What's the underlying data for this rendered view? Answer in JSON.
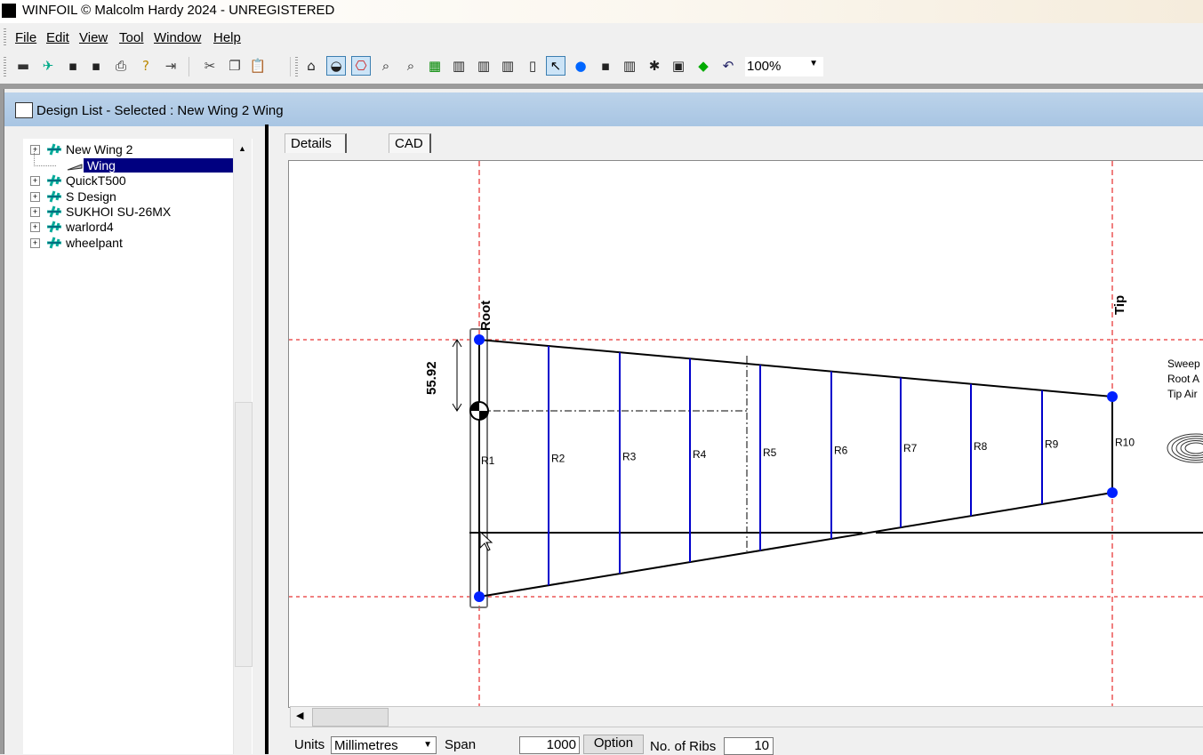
{
  "window": {
    "title": "WINFOIL © Malcolm Hardy 2024 - UNREGISTERED"
  },
  "menu": [
    "File",
    "Edit",
    "View",
    "Tool",
    "Window",
    "Help"
  ],
  "toolbar": {
    "icons": [
      "new-wing-icon",
      "new-design-icon",
      "save-icon",
      "save-as-icon",
      "print-icon",
      "help-icon",
      "exit-icon",
      "cut-icon",
      "copy-icon",
      "paste-icon",
      "plan-view-icon",
      "airfoil-view-icon",
      "outline-view-icon",
      "zoom-in-icon",
      "zoom-out-icon",
      "table-icon",
      "rib-chart-icon",
      "spar-chart-icon",
      "template-chart-icon",
      "panel-icon",
      "select-pointer-icon",
      "add-point-icon",
      "save-icon",
      "delete-icon",
      "tools-icon",
      "properties-icon",
      "color-icon",
      "undo-icon"
    ],
    "zoom": "100%"
  },
  "child": {
    "title": "Design List - Selected : New Wing 2 Wing"
  },
  "tree": [
    {
      "label": "New Wing 2",
      "expand": "+"
    },
    {
      "label": "Wing",
      "child": true,
      "selected": true
    },
    {
      "label": "QuickT500",
      "expand": "+"
    },
    {
      "label": "S Design",
      "expand": "+"
    },
    {
      "label": "SUKHOI SU-26MX",
      "expand": "+"
    },
    {
      "label": "warlord4",
      "expand": "+"
    },
    {
      "label": "wheelpant",
      "expand": "+"
    }
  ],
  "tabs": {
    "details": "Details",
    "cad": "CAD"
  },
  "drawing": {
    "root_label": "Root",
    "tip_label": "Tip",
    "dimension": "55.92",
    "ribs": [
      "R1",
      "R2",
      "R3",
      "R4",
      "R5",
      "R6",
      "R7",
      "R8",
      "R9",
      "R10"
    ],
    "info_lines": [
      "Sweep",
      "Root A",
      "Tip Air"
    ],
    "colors": {
      "guide": "#e00000",
      "rib": "#0000cc",
      "point": "#0020ff",
      "outline": "#000000"
    }
  },
  "footer": {
    "units_label": "Units",
    "units_value": "Millimetres",
    "span_label": "Span",
    "span_value": "1000",
    "option_button": "Option",
    "ribs_label": "No. of Ribs",
    "ribs_value": "10"
  }
}
